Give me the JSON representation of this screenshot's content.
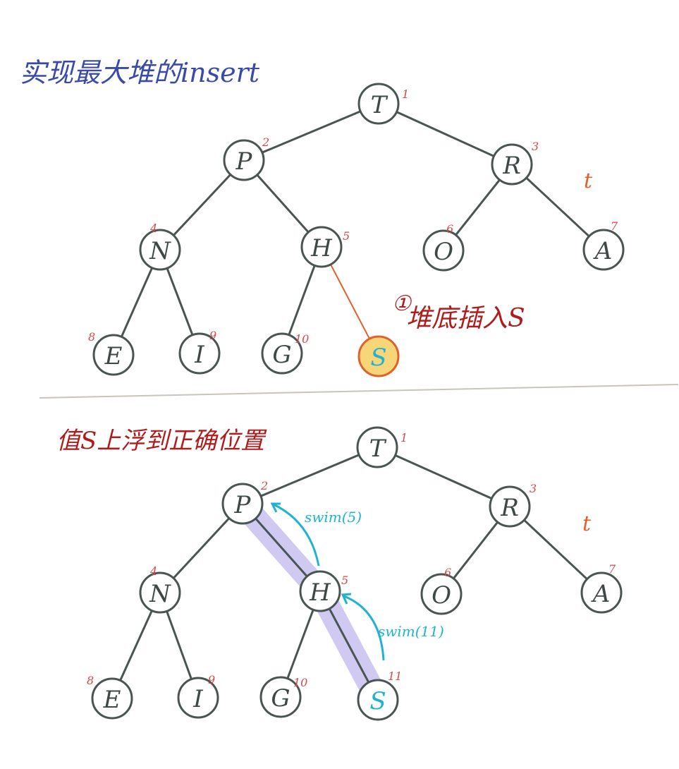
{
  "top": {
    "title": "实现最大堆的insert",
    "note_number": "①",
    "note_text": "堆底插入S",
    "side_mark": "t"
  },
  "bottom": {
    "title": "值S上浮到正确位置",
    "side_mark": "t",
    "swim_labels": [
      "swim(5)",
      "swim(11)"
    ]
  },
  "colors": {
    "ink": "#4a5553",
    "blue_title": "#3a4aa8",
    "red_text": "#b01c1c",
    "index_red": "#d44a4a",
    "swim_cyan": "#1fb3d1",
    "highlight_purple": "#c8c0f0",
    "inserted_fill": "#f7d67a",
    "inserted_stroke": "#e0612a",
    "new_edge": "#e0612a"
  },
  "trees": [
    {
      "nodes": [
        {
          "index": "1",
          "label": "T"
        },
        {
          "index": "2",
          "label": "P"
        },
        {
          "index": "3",
          "label": "R"
        },
        {
          "index": "4",
          "label": "N"
        },
        {
          "index": "5",
          "label": "H"
        },
        {
          "index": "6",
          "label": "O"
        },
        {
          "index": "7",
          "label": "A"
        },
        {
          "index": "8",
          "label": "E"
        },
        {
          "index": "9",
          "label": "I"
        },
        {
          "index": "10",
          "label": "G"
        },
        {
          "index": "",
          "label": "S",
          "inserted": true
        }
      ]
    },
    {
      "nodes": [
        {
          "index": "1",
          "label": "T"
        },
        {
          "index": "2",
          "label": "P"
        },
        {
          "index": "3",
          "label": "R"
        },
        {
          "index": "4",
          "label": "N"
        },
        {
          "index": "5",
          "label": "H"
        },
        {
          "index": "6",
          "label": "O"
        },
        {
          "index": "7",
          "label": "A"
        },
        {
          "index": "8",
          "label": "E"
        },
        {
          "index": "9",
          "label": "I"
        },
        {
          "index": "10",
          "label": "G"
        },
        {
          "index": "11",
          "label": "S",
          "swim_path": true
        }
      ]
    }
  ]
}
